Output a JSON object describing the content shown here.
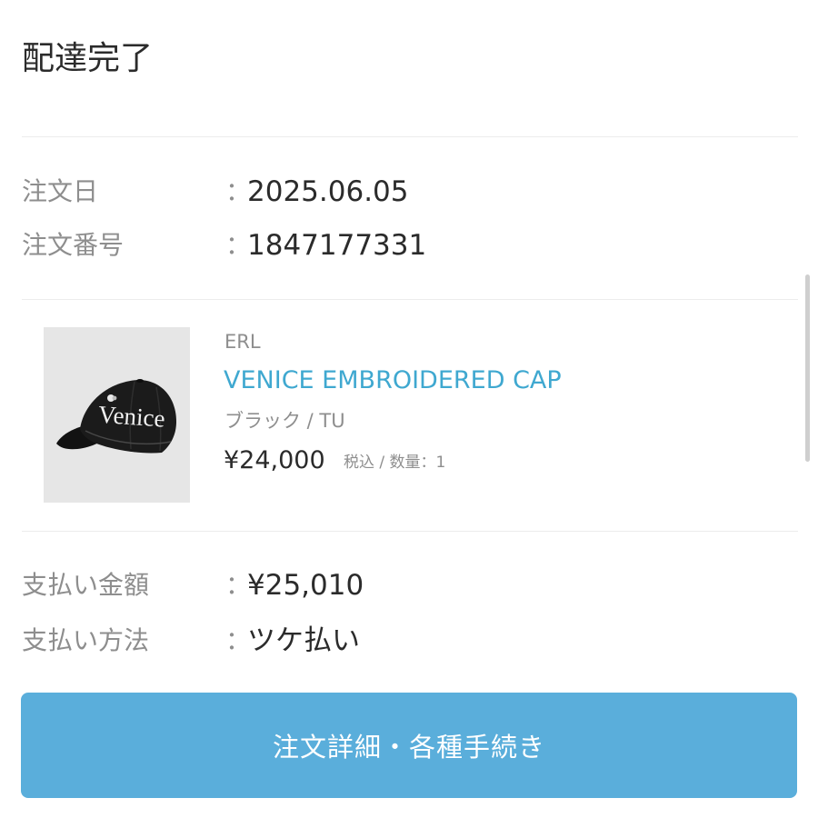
{
  "order": {
    "status": "配達完了",
    "info": [
      {
        "label": "注文日",
        "separator": "：",
        "value": "2025.06.05"
      },
      {
        "label": "注文番号",
        "separator": "：",
        "value": "1847177331"
      }
    ]
  },
  "product": {
    "brand": "ERL",
    "name": "VENICE EMBROIDERED CAP",
    "variant": "ブラック / TU",
    "price": "¥24,000",
    "meta": "税込 / 数量：1",
    "image_icon": "black-baseball-cap-image",
    "cap_text": "Venice"
  },
  "payment": [
    {
      "label": "支払い金額",
      "separator": "：",
      "value": "¥25,010"
    },
    {
      "label": "支払い方法",
      "separator": "：",
      "value": "ツケ払い"
    }
  ],
  "actions": {
    "detail_button_label": "注文詳細・各種手続き"
  },
  "colors": {
    "accent": "#3fa8d0",
    "button": "#5aaedb",
    "label": "#8e8e8e",
    "text": "#2b2b2b"
  }
}
